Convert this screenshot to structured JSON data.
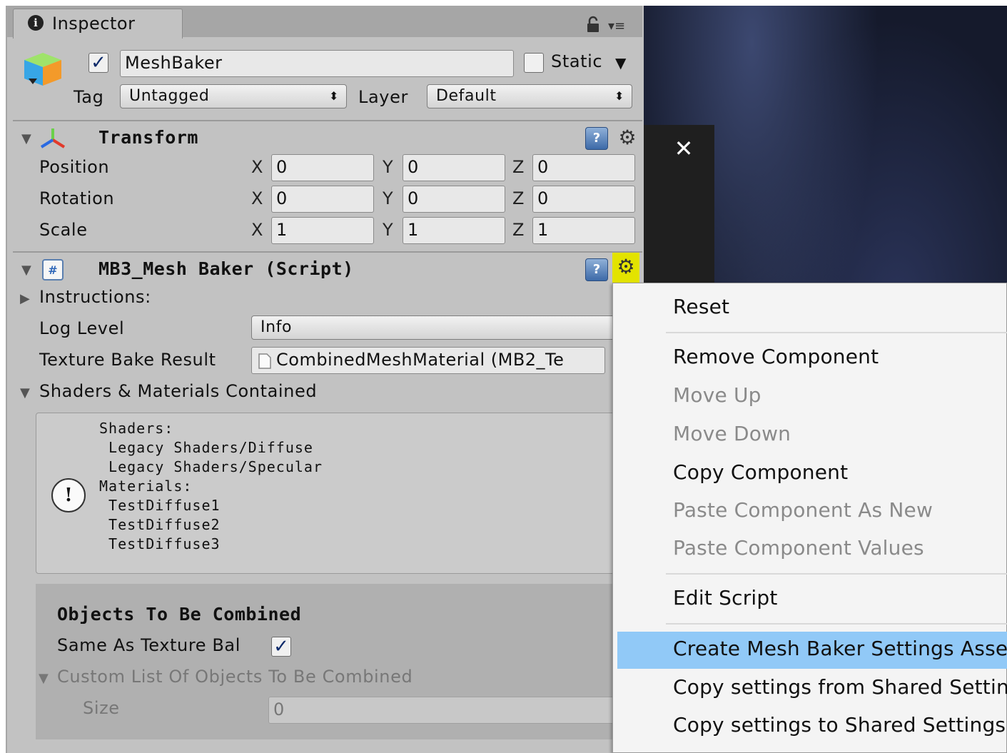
{
  "inspector": {
    "tab_label": "Inspector",
    "object_name": "MeshBaker",
    "active": true,
    "static_label": "Static",
    "static_checked": false,
    "tag_label": "Tag",
    "tag_value": "Untagged",
    "layer_label": "Layer",
    "layer_value": "Default"
  },
  "transform": {
    "title": "Transform",
    "rows": [
      {
        "label": "Position",
        "x": "0",
        "y": "0",
        "z": "0"
      },
      {
        "label": "Rotation",
        "x": "0",
        "y": "0",
        "z": "0"
      },
      {
        "label": "Scale",
        "x": "1",
        "y": "1",
        "z": "1"
      }
    ],
    "axes": [
      "X",
      "Y",
      "Z"
    ]
  },
  "script": {
    "title": "MB3_Mesh Baker (Script)",
    "instructions_label": "Instructions:",
    "log_level_label": "Log Level",
    "log_level_value": "Info",
    "texture_bake_label": "Texture Bake Result",
    "texture_bake_value": "CombinedMeshMaterial (MB2_Te",
    "shaders_materials_label": "Shaders & Materials Contained",
    "help_text": "Shaders:\n Legacy Shaders/Diffuse\n Legacy Shaders/Specular\nMaterials:\n TestDiffuse1\n TestDiffuse2\n TestDiffuse3",
    "objects_title": "Objects To Be Combined",
    "same_as_label": "Same As Texture Bal",
    "same_as_checked": true,
    "custom_list_label": "Custom List Of Objects To Be Combined",
    "size_label": "Size",
    "size_value": "0"
  },
  "context_menu": {
    "items": [
      {
        "label": "Reset",
        "enabled": true
      },
      {
        "label": "Remove Component",
        "enabled": true
      },
      {
        "label": "Move Up",
        "enabled": false
      },
      {
        "label": "Move Down",
        "enabled": false
      },
      {
        "label": "Copy Component",
        "enabled": true
      },
      {
        "label": "Paste Component As New",
        "enabled": false
      },
      {
        "label": "Paste Component Values",
        "enabled": false
      },
      {
        "label": "Edit Script",
        "enabled": true
      },
      {
        "label": "Create Mesh Baker Settings Asset",
        "enabled": true,
        "highlighted": true
      },
      {
        "label": "Copy settings from Shared Settings",
        "enabled": true
      },
      {
        "label": "Copy settings to Shared Settings",
        "enabled": true
      }
    ],
    "highlight_color": "#91c9f7"
  },
  "overlay": {
    "close_glyph": "✕"
  },
  "icons": {
    "info": "i",
    "help": "?",
    "gear": "⚙",
    "warning": "!",
    "check": "✓",
    "fold_open": "▼",
    "fold_closed": "▶",
    "popup_arrows": "⬍",
    "menu": "▾≡"
  }
}
